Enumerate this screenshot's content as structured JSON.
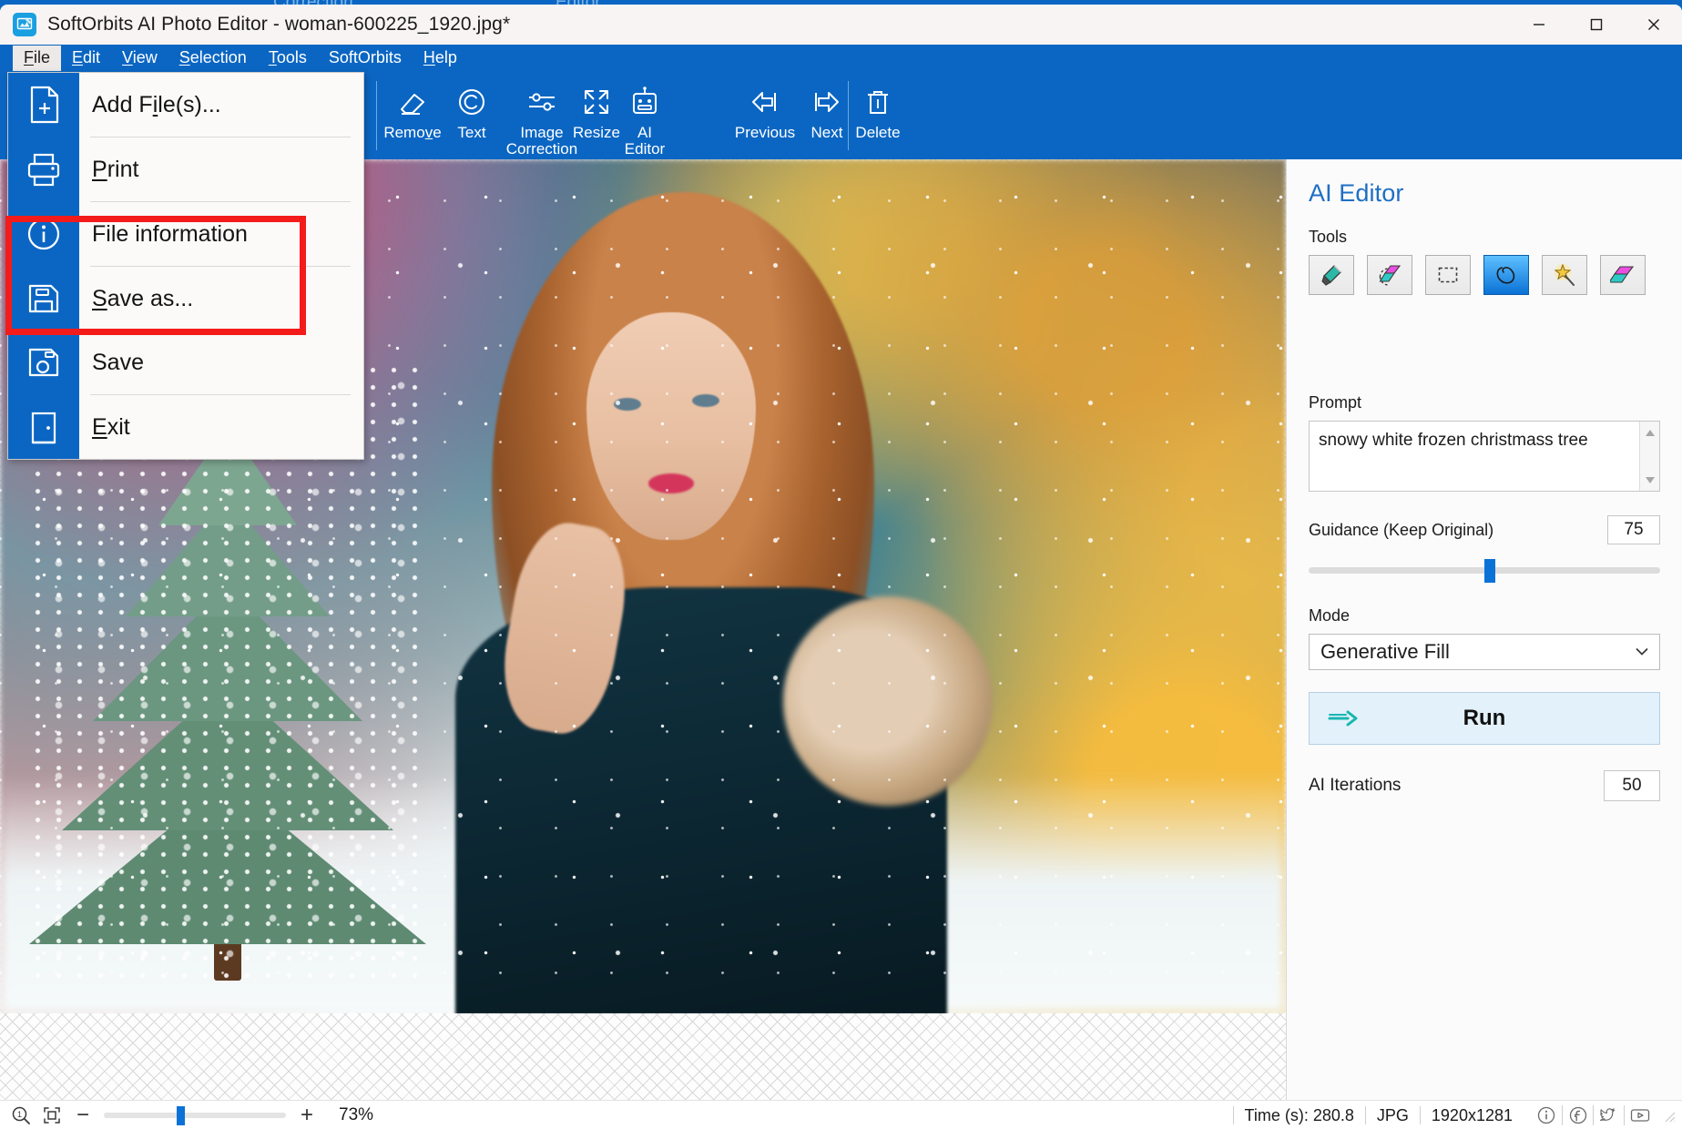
{
  "window": {
    "title": "SoftOrbits AI Photo Editor - woman-600225_1920.jpg*",
    "app_icon": "photo-editor-icon",
    "minimize_label": "Minimize",
    "maximize_label": "Maximize",
    "close_label": "Close",
    "accent_color": "#0b66c3",
    "ghost_labels": [
      "Correction",
      "Editor"
    ]
  },
  "menubar": {
    "items": [
      {
        "label": "File",
        "mnemonic": "F",
        "active": true
      },
      {
        "label": "Edit",
        "mnemonic": "E",
        "active": false
      },
      {
        "label": "View",
        "mnemonic": "V",
        "active": false
      },
      {
        "label": "Selection",
        "mnemonic": "S",
        "active": false
      },
      {
        "label": "Tools",
        "mnemonic": "T",
        "active": false
      },
      {
        "label": "SoftOrbits",
        "mnemonic": "",
        "active": false
      },
      {
        "label": "Help",
        "mnemonic": "H",
        "active": false
      }
    ]
  },
  "file_menu": {
    "items": [
      {
        "label": "Add File(s)...",
        "icon": "file-add-icon",
        "mnemonic": "i",
        "highlighted": false
      },
      {
        "label": "Print",
        "icon": "printer-icon",
        "mnemonic": "P",
        "highlighted": false
      },
      {
        "label": "File information",
        "icon": "info-circle-icon",
        "mnemonic": "",
        "highlighted": false
      },
      {
        "label": "Save as...",
        "icon": "floppy-save-as-icon",
        "mnemonic": "S",
        "highlighted": true
      },
      {
        "label": "Save",
        "icon": "floppy-save-icon",
        "mnemonic": "",
        "highlighted": true
      },
      {
        "label": "Exit",
        "icon": "exit-door-icon",
        "mnemonic": "E",
        "highlighted": false
      }
    ],
    "highlight_color": "#f41b1b"
  },
  "toolbar": {
    "buttons": [
      {
        "label": "Remove",
        "icon": "eraser-icon",
        "mnemonic": "v"
      },
      {
        "label": "Text",
        "icon": "copyright-icon",
        "mnemonic": ""
      },
      {
        "label": "Image\nCorrection",
        "icon": "sliders-icon",
        "mnemonic": ""
      },
      {
        "label": "Resize",
        "icon": "expand-arrows-icon",
        "mnemonic": ""
      },
      {
        "label": "AI\nEditor",
        "icon": "robot-icon",
        "mnemonic": ""
      },
      {
        "label": "Previous",
        "icon": "arrow-left-icon",
        "mnemonic": ""
      },
      {
        "label": "Next",
        "icon": "arrow-right-icon",
        "mnemonic": ""
      },
      {
        "label": "Delete",
        "icon": "trash-icon",
        "mnemonic": ""
      }
    ]
  },
  "panel": {
    "title": "AI Editor",
    "tools_label": "Tools",
    "tools": [
      {
        "name": "brush-tool",
        "icon": "marker-pen-icon",
        "selected": false
      },
      {
        "name": "eraser-selection-tool",
        "icon": "eraser-dashed-icon",
        "selected": false
      },
      {
        "name": "rectangle-select-tool",
        "icon": "dashed-rectangle-icon",
        "selected": false
      },
      {
        "name": "lasso-select-tool",
        "icon": "lasso-icon",
        "selected": true
      },
      {
        "name": "magic-wand-tool",
        "icon": "magic-wand-icon",
        "selected": false
      },
      {
        "name": "fill-tool",
        "icon": "parallelogram-fill-icon",
        "selected": false
      }
    ],
    "prompt_label": "Prompt",
    "prompt_value": "snowy white frozen christmass tree",
    "prompt_placeholder": "",
    "guidance_label": "Guidance (Keep Original)",
    "guidance_value": "75",
    "guidance_min": 0,
    "guidance_max": 100,
    "mode_label": "Mode",
    "mode_value": "Generative Fill",
    "mode_options": [
      "Generative Fill"
    ],
    "run_label": "Run",
    "run_icon": "right-arrow-icon",
    "iterations_label": "AI Iterations",
    "iterations_value": "50"
  },
  "statusbar": {
    "zoom_icon": "zoom-1-to-1-icon",
    "fit_icon": "fit-to-window-icon",
    "zoom_out_label": "−",
    "zoom_in_label": "+",
    "zoom_percent": "73%",
    "zoom_position_pct": 40,
    "time_label": "Time (s): 280.8",
    "format_label": "JPG",
    "dimensions_label": "1920x1281",
    "social": [
      {
        "name": "info-icon"
      },
      {
        "name": "facebook-icon"
      },
      {
        "name": "twitter-icon"
      },
      {
        "name": "youtube-icon"
      }
    ]
  }
}
